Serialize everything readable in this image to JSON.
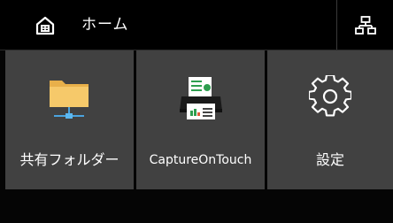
{
  "header": {
    "home_label": "ホーム",
    "home_icon": "home-icon",
    "network_icon": "network-icon"
  },
  "tiles": [
    {
      "label": "共有フォルダー",
      "icon": "shared-folder-icon"
    },
    {
      "label": "CaptureOnTouch",
      "icon": "scanner-icon"
    },
    {
      "label": "設定",
      "icon": "settings-gear-icon"
    }
  ],
  "colors": {
    "background": "#050505",
    "tile": "#414141",
    "text": "#ffffff",
    "folder": "#f6c96a"
  }
}
